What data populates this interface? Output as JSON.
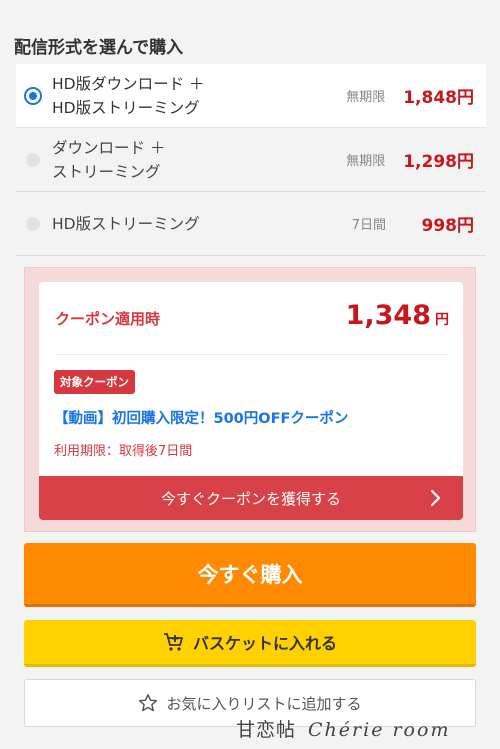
{
  "section_title": "配信形式を選んで購入",
  "options": [
    {
      "label": "HD版ダウンロード ＋\nHD版ストリーミング",
      "period": "無期限",
      "price": "1,848円",
      "selected": true
    },
    {
      "label": "ダウンロード ＋\nストリーミング",
      "period": "無期限",
      "price": "1,298円",
      "selected": false
    },
    {
      "label": "HD版ストリーミング",
      "period": "7日間",
      "price": "998円",
      "selected": false
    }
  ],
  "coupon": {
    "heading": "クーポン適用時",
    "price_value": "1,348",
    "price_unit": "円",
    "badge": "対象クーポン",
    "name": "【動画】初回購入限定！500円OFFクーポン",
    "expiry": "利用期限：取得後7日間",
    "cta_label": "今すぐクーポンを獲得する"
  },
  "buttons": {
    "buy_now": "今すぐ購入",
    "basket": "バスケットに入れる",
    "wishlist": "お気に入りリストに追加する"
  },
  "watermark": {
    "jp": "甘恋帖",
    "latin": "Chérie room"
  },
  "colors": {
    "price_red": "#c8161d",
    "coupon_red": "#d94148",
    "buy_orange": "#ff8a00",
    "basket_yellow": "#ffd100",
    "link_blue": "#1a73e8"
  },
  "icons": {
    "cta_arrow": "chevron-right-icon",
    "basket": "cart-add-icon",
    "wishlist": "star-outline-icon"
  }
}
